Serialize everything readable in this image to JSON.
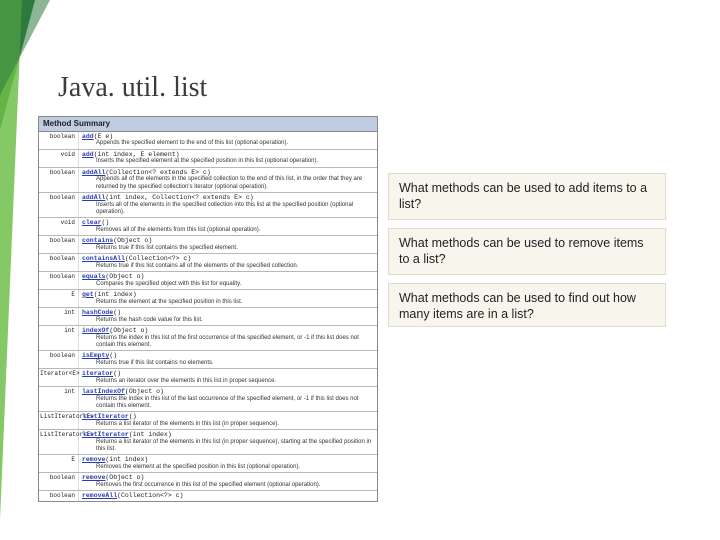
{
  "title": "Java. util. list",
  "api": {
    "header": "Method Summary",
    "rows": [
      {
        "ret": "boolean",
        "sig_link": "add",
        "sig_rest": "(E e)",
        "desc": "Appends the specified element to the end of this list (optional operation)."
      },
      {
        "ret": "void",
        "sig_link": "add",
        "sig_rest": "(int index, E element)",
        "desc": "Inserts the specified element at the specified position in this list (optional operation)."
      },
      {
        "ret": "boolean",
        "sig_link": "addAll",
        "sig_rest": "(Collection<? extends E> c)",
        "desc": "Appends all of the elements in the specified collection to the end of this list, in the order that they are returned by the specified collection's iterator (optional operation)."
      },
      {
        "ret": "boolean",
        "sig_link": "addAll",
        "sig_rest": "(int index, Collection<? extends E> c)",
        "desc": "Inserts all of the elements in the specified collection into this list at the specified position (optional operation)."
      },
      {
        "ret": "void",
        "sig_link": "clear",
        "sig_rest": "()",
        "desc": "Removes all of the elements from this list (optional operation)."
      },
      {
        "ret": "boolean",
        "sig_link": "contains",
        "sig_rest": "(Object o)",
        "desc": "Returns true if this list contains the specified element."
      },
      {
        "ret": "boolean",
        "sig_link": "containsAll",
        "sig_rest": "(Collection<?> c)",
        "desc": "Returns true if this list contains all of the elements of the specified collection."
      },
      {
        "ret": "boolean",
        "sig_link": "equals",
        "sig_rest": "(Object o)",
        "desc": "Compares the specified object with this list for equality."
      },
      {
        "ret": "E",
        "sig_link": "get",
        "sig_rest": "(int index)",
        "desc": "Returns the element at the specified position in this list."
      },
      {
        "ret": "int",
        "sig_link": "hashCode",
        "sig_rest": "()",
        "desc": "Returns the hash code value for this list."
      },
      {
        "ret": "int",
        "sig_link": "indexOf",
        "sig_rest": "(Object o)",
        "desc": "Returns the index in this list of the first occurrence of the specified element, or -1 if this list does not contain this element."
      },
      {
        "ret": "boolean",
        "sig_link": "isEmpty",
        "sig_rest": "()",
        "desc": "Returns true if this list contains no elements."
      },
      {
        "ret": "Iterator<E>",
        "sig_link": "iterator",
        "sig_rest": "()",
        "desc": "Returns an iterator over the elements in this list in proper sequence."
      },
      {
        "ret": "int",
        "sig_link": "lastIndexOf",
        "sig_rest": "(Object o)",
        "desc": "Returns the index in this list of the last occurrence of the specified element, or -1 if this list does not contain this element."
      },
      {
        "ret": "ListIterator<E>",
        "sig_link": "listIterator",
        "sig_rest": "()",
        "desc": "Returns a list iterator of the elements in this list (in proper sequence)."
      },
      {
        "ret": "ListIterator<E>",
        "sig_link": "listIterator",
        "sig_rest": "(int index)",
        "desc": "Returns a list iterator of the elements in this list (in proper sequence), starting at the specified position in this list."
      },
      {
        "ret": "E",
        "sig_link": "remove",
        "sig_rest": "(int index)",
        "desc": "Removes the element at the specified position in this list (optional operation)."
      },
      {
        "ret": "boolean",
        "sig_link": "remove",
        "sig_rest": "(Object o)",
        "desc": "Removes the first occurrence in this list of the specified element (optional operation)."
      },
      {
        "ret": "boolean",
        "sig_link": "removeAll",
        "sig_rest": "(Collection<?> c)",
        "desc": ""
      }
    ]
  },
  "questions": {
    "q1": "What methods can be used to add items to a list?",
    "q2": "What methods can be used to remove items to a list?",
    "q3": "What methods can be used to find out how many items are in a list?"
  },
  "colors": {
    "accent_green_dark": "#2d7a3e",
    "accent_green_light": "#6fbf4a"
  }
}
